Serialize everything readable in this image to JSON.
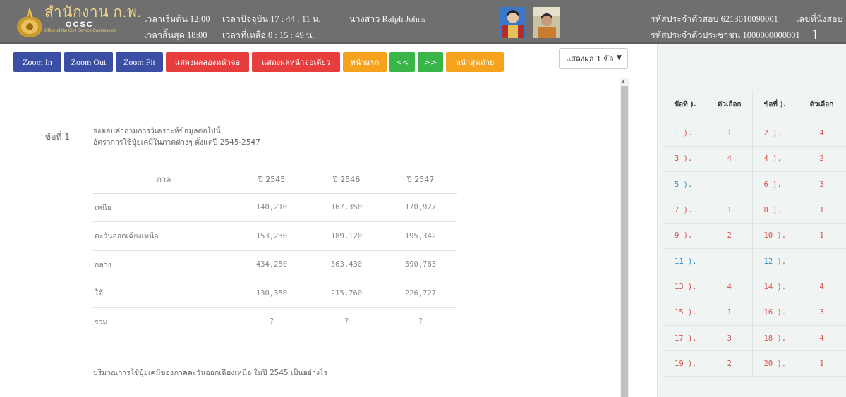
{
  "header": {
    "brand_title": "สำนักงาน ก.พ.",
    "brand_abbr": "OCSC",
    "brand_sub": "Office of the Civil Service Commission",
    "start_time": "เวลาเริ่มต้น 12:00",
    "end_time": "เวลาสิ้นสุด 18:00",
    "current_time": "เวลาปัจจุบัน 17 : 44 : 11 น.",
    "remaining_time": "เวลาที่เหลือ 0 : 15 : 49 น.",
    "candidate_name": "นางสาว Ralph Johns",
    "exam_id": "รหัสประจำตัวสอบ 6213010090001",
    "citizen_id": "รหัสประจำตัวประชาชน 1000000000001",
    "seat_label": "เลขที่นั่งสอบ",
    "seat_number": "1"
  },
  "toolbar": {
    "zoom_in": "Zoom In",
    "zoom_out": "Zoom Out",
    "zoom_fit": "Zoom Fit",
    "two_screen": "แสดงผลสองหน้าจอ",
    "one_screen": "แสดงผลหน้าจอเดียว",
    "first_page": "หน้าแรก",
    "prev": "<<",
    "next": ">>",
    "last_page": "หน้าสุดท้าย",
    "display_select": "แสดงผล 1 ข้อ"
  },
  "question": {
    "label": "ข้อที่ 1",
    "instruction": "จงตอบคำถามการวิเคราะห์ข้อมูลต่อไปนี้",
    "subtitle": "อัตราการใช้ปุ๋ยเคมีในภาคต่างๆ ตั้งแต่ปี 2545-2547",
    "table_headers": [
      "ภาค",
      "ปี 2545",
      "ปี 2546",
      "ปี 2547"
    ],
    "table_rows": [
      [
        "เหนือ",
        "140,210",
        "167,350",
        "170,927"
      ],
      [
        "ตะวันออกเฉียงเหนือ",
        "153,230",
        "189,120",
        "195,342"
      ],
      [
        "กลาง",
        "434,250",
        "563,430",
        "590,783"
      ],
      [
        "ใต้",
        "130,350",
        "215,760",
        "226,727"
      ],
      [
        "รวม",
        "?",
        "?",
        "?"
      ]
    ],
    "prompt": "ปริมาณการใช้ปุ๋ยเคมีของภาคตะวันออกเฉียงเหนือ ในปี 2545 เป็นอย่างไร"
  },
  "answers": {
    "headers": [
      "ข้อที่ ).",
      "ตัวเลือก",
      "ข้อที่ ).",
      "ตัวเลือก"
    ],
    "rows": [
      [
        "1 ).",
        "1",
        "2 ).",
        "4"
      ],
      [
        "3 ).",
        "4",
        "4 ).",
        "2"
      ],
      [
        "5 ).",
        "",
        "6 ).",
        "3"
      ],
      [
        "7 ).",
        "1",
        "8 ).",
        "1"
      ],
      [
        "9 ).",
        "2",
        "10 ).",
        "1"
      ],
      [
        "11 ).",
        "",
        "12 ).",
        ""
      ],
      [
        "13 ).",
        "4",
        "14 ).",
        "4"
      ],
      [
        "15 ).",
        "1",
        "16 ).",
        "3"
      ],
      [
        "17 ).",
        "3",
        "18 ).",
        "4"
      ],
      [
        "19 ).",
        "2",
        "20 ).",
        "1"
      ]
    ]
  },
  "colors": {
    "header_bg": "#6f6f6f",
    "brand_gold": "#f0d48a",
    "button_blue": "#3a4ea3",
    "button_red": "#e83d3d",
    "button_orange": "#f5a31c",
    "button_green": "#39b54a",
    "answered": "#d9534f",
    "unanswered": "#2a8fc4",
    "side_bg": "#f0f5f3"
  },
  "icons": {
    "logo": "ocsc-emblem-icon",
    "dropdown": "caret-down-icon",
    "scroll_up": "scroll-up-arrow-icon"
  }
}
